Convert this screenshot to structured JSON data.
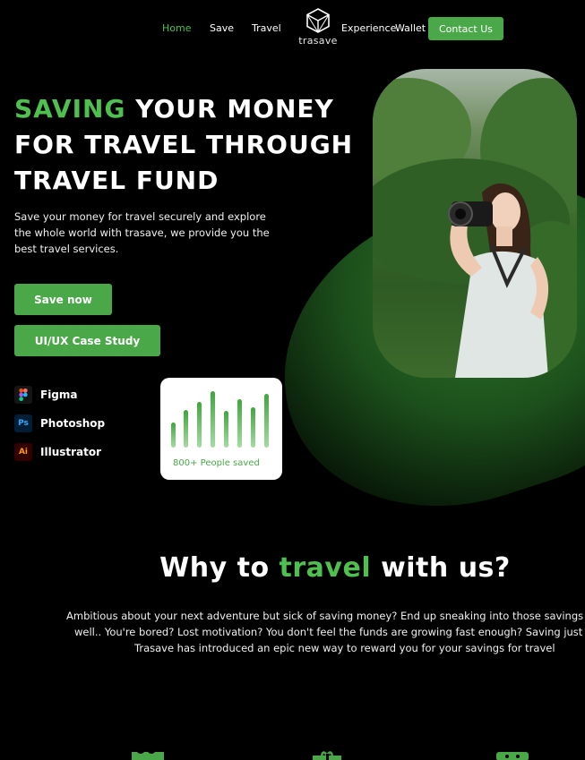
{
  "nav": {
    "links": [
      "Home",
      "Save",
      "Travel",
      "Experience",
      "Wallet"
    ],
    "logo_text": "trasave",
    "contact_label": "Contact Us",
    "accent_color": "#4fbf4f"
  },
  "hero": {
    "title_green": "SAVING",
    "title_rest": "YOUR MONEY FOR TRAVEL THROUGH TRAVEL FUND",
    "description": "Save your money for travel securely and explore the whole world with trasave, we provide you the best travel services.",
    "save_button": "Save now",
    "case_button": "UI/UX Case Study",
    "tools": [
      {
        "name": "Figma",
        "icon": "figma-icon"
      },
      {
        "name": "Photoshop",
        "icon": "photoshop-icon",
        "glyph": "Ps"
      },
      {
        "name": "Illustrator",
        "icon": "illustrator-icon",
        "glyph": "Ai"
      }
    ],
    "stat_label": "800+ People saved",
    "photo_icon": "traveler-photo"
  },
  "why": {
    "title_before": "Why to",
    "title_green": "travel",
    "title_after": "with us?",
    "line1": "Ambitious about your next adventure but sick of saving money? End up sneaking into those savings beca",
    "line2": "well.. You're bored? Lost motivation? You don't feel the funds are growing fast enough? Saving just suck",
    "line3": "Trasave has introduced an epic new way to reward you for your savings for travel"
  },
  "features": {
    "icons": [
      "ticket-icon",
      "gift-icon",
      "wallet-icon"
    ]
  }
}
